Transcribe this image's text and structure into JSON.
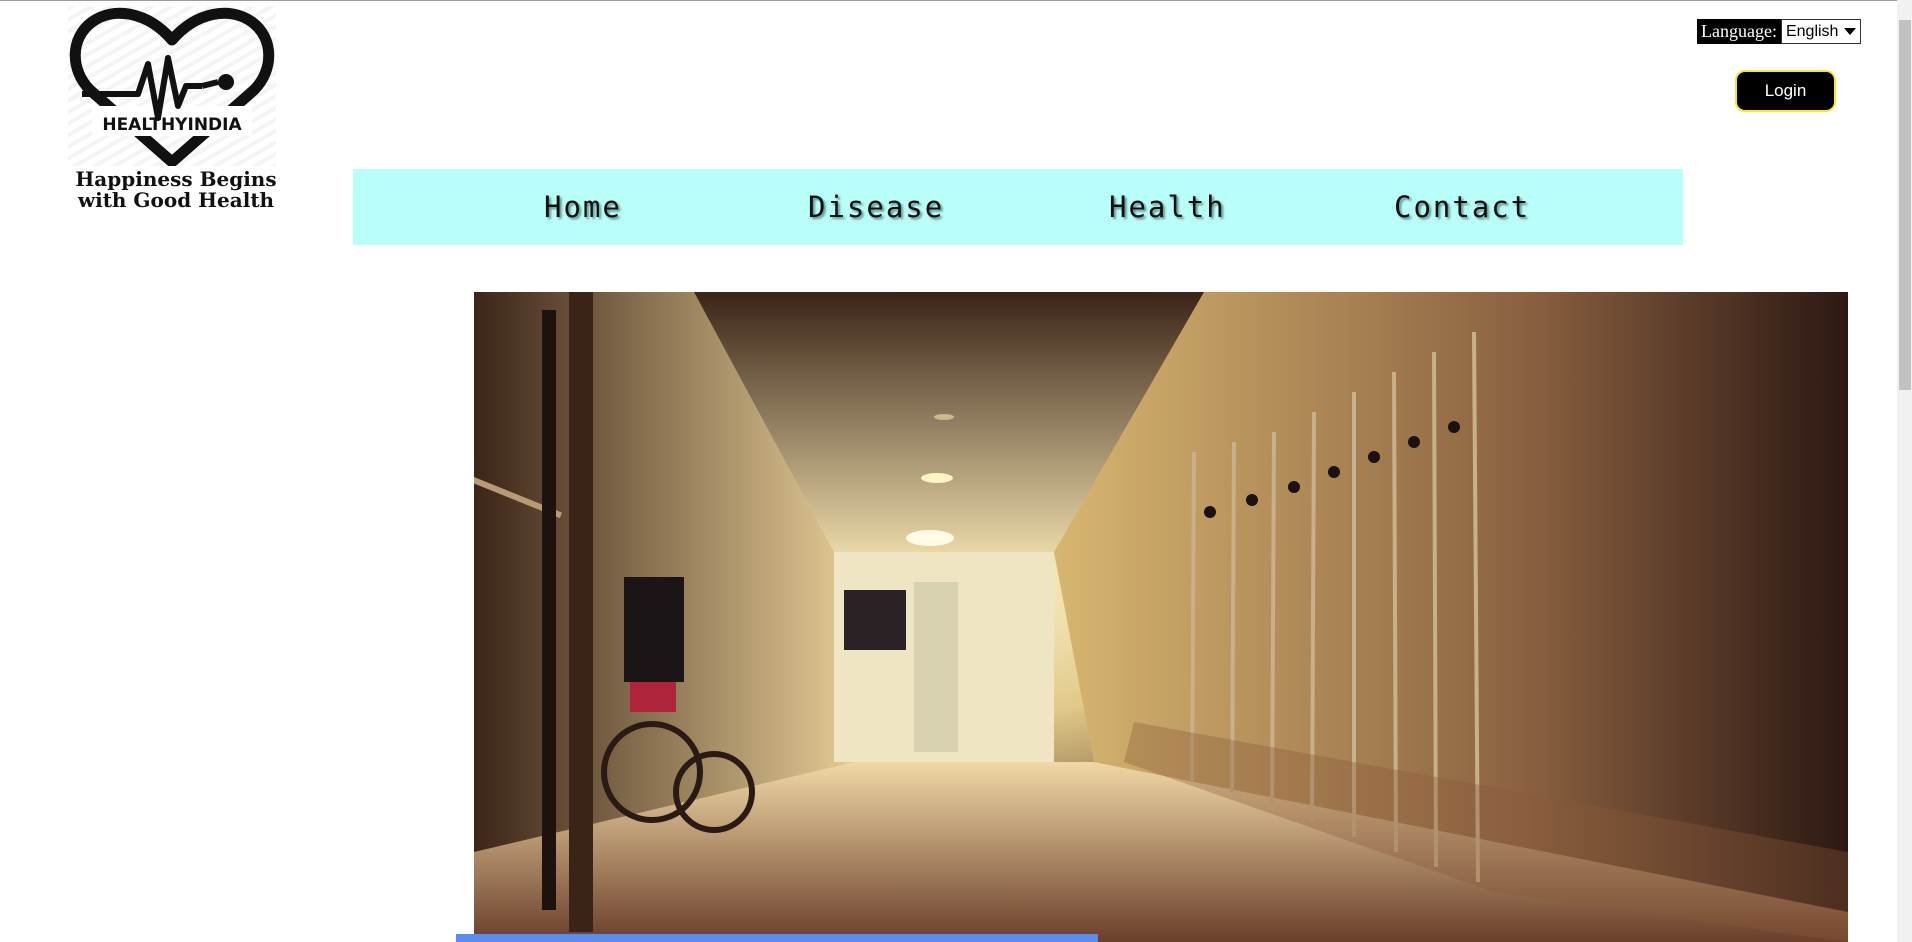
{
  "header": {
    "logo": {
      "text": "HEALTHYINDIA",
      "icon": "heart-pulse-icon"
    },
    "tagline": "Happiness Begins with Good Health",
    "language": {
      "label": "Language:",
      "selected": "English"
    },
    "login_label": "Login"
  },
  "nav": {
    "items": [
      {
        "label": "Home"
      },
      {
        "label": "Disease"
      },
      {
        "label": "Health"
      },
      {
        "label": "Contact"
      }
    ],
    "background": "#b8fff9"
  },
  "hero": {
    "icon": "hospital-corridor-image"
  },
  "colors": {
    "login_border": "#f2ea2a",
    "progress": "#5b8def"
  }
}
